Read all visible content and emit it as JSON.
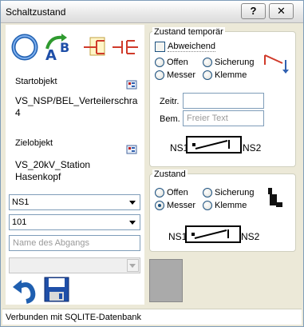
{
  "window": {
    "title": "Schaltzustand",
    "help_glyph": "?",
    "close_glyph": "✕"
  },
  "toolbar": {
    "icons": [
      "refresh-circle-icon",
      "ab-swap-icon",
      "branch-icon",
      "disconnect-icon"
    ]
  },
  "start": {
    "label": "Startobjekt",
    "value_line1": "VS_NSP/BEL_Verteilerschra",
    "value_line2": "4"
  },
  "target": {
    "label": "Zielobjekt",
    "value_line1": "VS_20kV_Station",
    "value_line2": "Hasenkopf"
  },
  "selects": {
    "ns": "NS1",
    "num": "101",
    "abgang_placeholder": "Name des Abgangs",
    "disabled_value": ""
  },
  "temp": {
    "title": "Zustand temporär",
    "abweichend": "Abweichend",
    "radio_offen": "Offen",
    "radio_sicherung": "Sicherung",
    "radio_messer": "Messer",
    "radio_klemme": "Klemme",
    "zeitr_label": "Zeitr.",
    "zeitr_value": "",
    "bem_label": "Bem.",
    "bem_placeholder": "Freier Text",
    "left_terminal": "NS1",
    "right_terminal": "NS2"
  },
  "state": {
    "title": "Zustand",
    "radio_offen": "Offen",
    "radio_sicherung": "Sicherung",
    "radio_messer": "Messer",
    "radio_klemme": "Klemme",
    "selected": "Messer",
    "left_terminal": "NS1",
    "right_terminal": "NS2"
  },
  "status": {
    "text": "Verbunden mit SQLITE-Datenbank"
  },
  "colors": {
    "accent": "#1c5180",
    "panel": "#ECE9D8",
    "disabled_box": "#aaaaaa"
  }
}
